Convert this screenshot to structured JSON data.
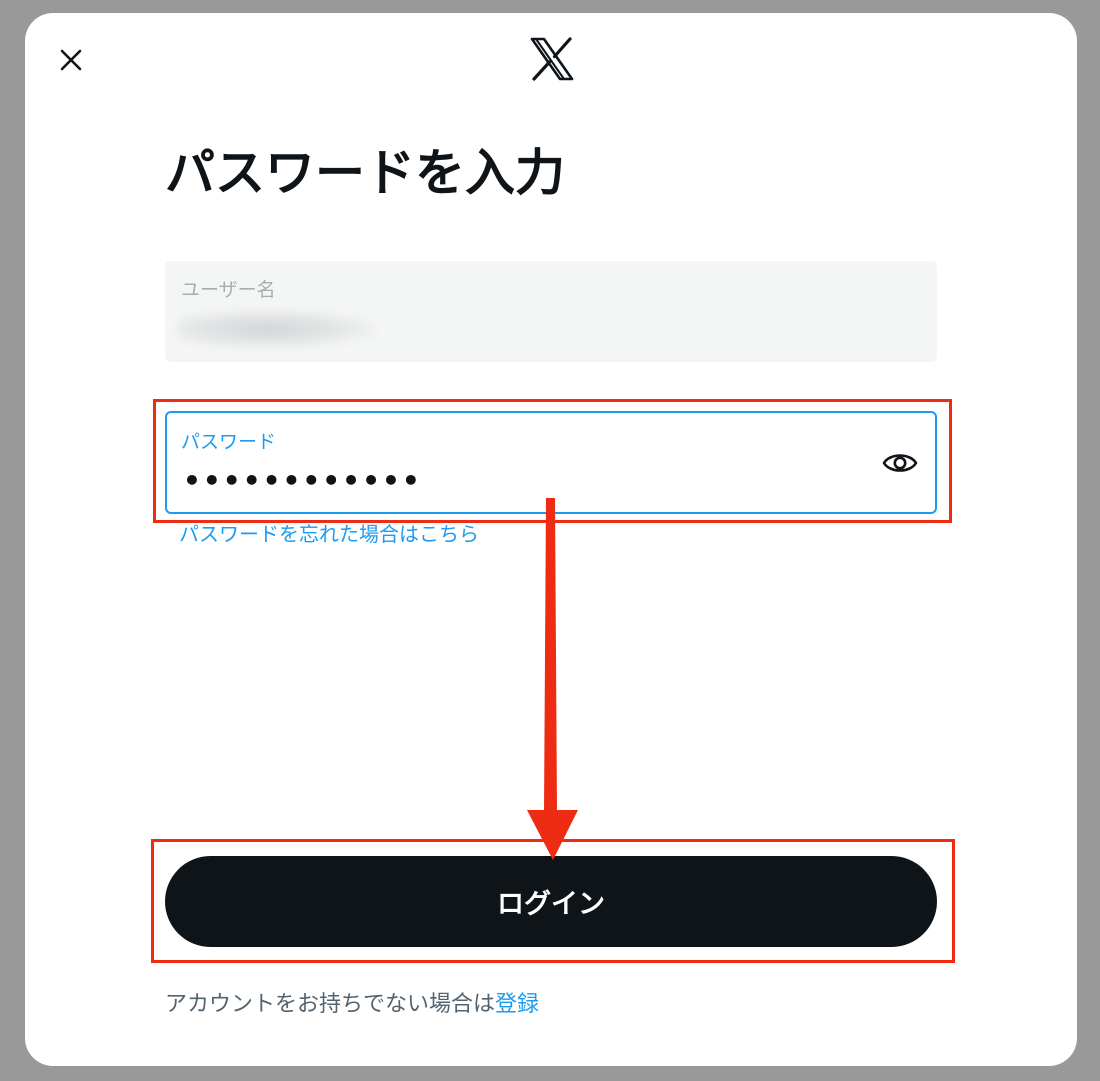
{
  "header": {
    "close_icon": "close-icon",
    "logo_icon": "x-logo-icon"
  },
  "main": {
    "title": "パスワードを入力",
    "username_field": {
      "label": "ユーザー名"
    },
    "password_field": {
      "label": "パスワード",
      "value": "••••••••••••",
      "visibility_icon": "eye-icon"
    },
    "forgot_password_link": "パスワードを忘れた場合はこちら",
    "login_button_label": "ログイン"
  },
  "footer": {
    "no_account_text": "アカウントをお持ちでない場合は",
    "signup_link": "登録"
  },
  "annotations": {
    "highlight_color": "#ee2c13",
    "arrow_color": "#ee2c13"
  },
  "colors": {
    "accent": "#1d9bf0",
    "button_bg": "#0f1419",
    "backdrop": "#999999"
  }
}
